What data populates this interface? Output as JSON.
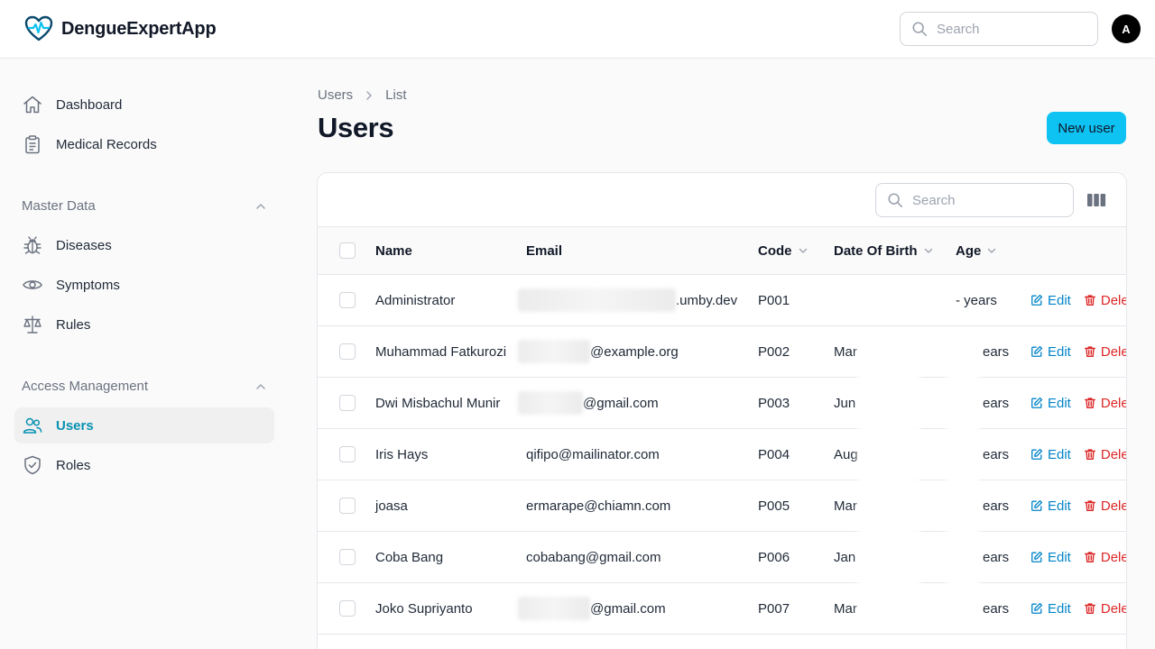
{
  "app": {
    "name": "DengueExpertApp",
    "avatar_initial": "A"
  },
  "header": {
    "search_placeholder": "Search"
  },
  "sidebar": {
    "items": [
      {
        "label": "Dashboard",
        "icon": "home-icon"
      },
      {
        "label": "Medical Records",
        "icon": "clipboard-icon"
      }
    ],
    "groups": [
      {
        "label": "Master Data",
        "items": [
          {
            "label": "Diseases",
            "icon": "bug-icon"
          },
          {
            "label": "Symptoms",
            "icon": "eye-icon"
          },
          {
            "label": "Rules",
            "icon": "scale-icon"
          }
        ]
      },
      {
        "label": "Access Management",
        "items": [
          {
            "label": "Users",
            "icon": "users-icon",
            "active": true
          },
          {
            "label": "Roles",
            "icon": "shield-icon"
          }
        ]
      }
    ]
  },
  "breadcrumb": {
    "items": [
      "Users",
      "List"
    ]
  },
  "page": {
    "title": "Users",
    "new_button": "New user"
  },
  "table": {
    "search_placeholder": "Search",
    "columns": {
      "name": "Name",
      "email": "Email",
      "code": "Code",
      "dob": "Date Of Birth",
      "age": "Age"
    },
    "edit_label": "Edit",
    "delete_label": "Dele",
    "rows": [
      {
        "name": "Administrator",
        "email": ".umby.dev",
        "code": "P001",
        "dob": "",
        "age": "- years"
      },
      {
        "name": "Muhammad Fatkurozi",
        "email": "@example.org",
        "code": "P002",
        "dob": "Mar",
        "age": "ears"
      },
      {
        "name": "Dwi Misbachul Munir",
        "email": "@gmail.com",
        "code": "P003",
        "dob": "Jun",
        "age": "ears"
      },
      {
        "name": "Iris Hays",
        "email": "qifipo@mailinator.com",
        "code": "P004",
        "dob": "Aug",
        "age": "ears"
      },
      {
        "name": "joasa",
        "email": "ermarape@chiamn.com",
        "code": "P005",
        "dob": "Mar",
        "age": "ears"
      },
      {
        "name": "Coba Bang",
        "email": "cobabang@gmail.com",
        "code": "P006",
        "dob": "Jan",
        "age": "ears"
      },
      {
        "name": "Joko Supriyanto",
        "email": "@gmail.com",
        "code": "P007",
        "dob": "Mar",
        "age": "ears"
      }
    ]
  },
  "colors": {
    "accent": "#0ec2f2",
    "active_text": "#0891b2",
    "edit": "#0284c7",
    "delete": "#dc2626"
  }
}
